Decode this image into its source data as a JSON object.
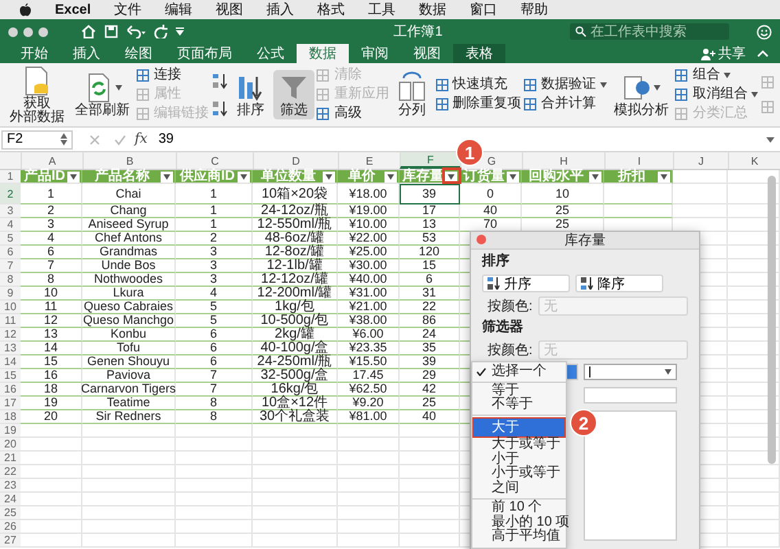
{
  "menu_bar": {
    "app": "Excel",
    "items": [
      "文件",
      "编辑",
      "视图",
      "插入",
      "格式",
      "工具",
      "数据",
      "窗口",
      "帮助"
    ]
  },
  "title_bar": {
    "title": "工作簿1",
    "search": {
      "placeholder": "在工作表中搜索"
    }
  },
  "tabs": [
    {
      "label": "开始",
      "selected": false,
      "kind": "normal"
    },
    {
      "label": "插入",
      "selected": false,
      "kind": "normal"
    },
    {
      "label": "绘图",
      "selected": false,
      "kind": "normal"
    },
    {
      "label": "页面布局",
      "selected": false,
      "kind": "normal"
    },
    {
      "label": "公式",
      "selected": false,
      "kind": "normal"
    },
    {
      "label": "数据",
      "selected": true,
      "kind": "normal"
    },
    {
      "label": "审阅",
      "selected": false,
      "kind": "normal"
    },
    {
      "label": "视图",
      "selected": false,
      "kind": "normal"
    },
    {
      "label": "表格",
      "selected": false,
      "kind": "contextual"
    }
  ],
  "share": "共享",
  "ribbon": {
    "groups": [
      {
        "kind": "big",
        "label_lines": [
          "获取",
          "外部数据"
        ],
        "pressed": false,
        "dropdown": false
      },
      {
        "kind": "big",
        "label": "全部刷新",
        "pressed": false,
        "dropdown": true
      },
      {
        "kind": "stack",
        "items": [
          {
            "label": "连接",
            "disabled": false,
            "dropdown": false
          },
          {
            "label": "属性",
            "disabled": true,
            "dropdown": false
          },
          {
            "label": "编辑链接",
            "disabled": true,
            "dropdown": false
          }
        ]
      },
      {
        "kind": "sort_icons"
      },
      {
        "kind": "big",
        "label": "排序",
        "pressed": false,
        "dropdown": false
      },
      {
        "kind": "big",
        "label": "筛选",
        "pressed": true,
        "dropdown": false
      },
      {
        "kind": "stack",
        "items": [
          {
            "label": "清除",
            "disabled": true,
            "dropdown": false
          },
          {
            "label": "重新应用",
            "disabled": true,
            "dropdown": false
          },
          {
            "label": "高级",
            "disabled": false,
            "dropdown": false
          }
        ]
      },
      {
        "kind": "big",
        "label": "分列",
        "pressed": false,
        "dropdown": false
      },
      {
        "kind": "stack",
        "items": [
          {
            "label": "快速填充",
            "disabled": false,
            "dropdown": false
          },
          {
            "label": "删除重复项",
            "disabled": false,
            "dropdown": false
          }
        ]
      },
      {
        "kind": "stack",
        "items": [
          {
            "label": "数据验证",
            "disabled": false,
            "dropdown": true
          },
          {
            "label": "合并计算",
            "disabled": false,
            "dropdown": false
          }
        ]
      },
      {
        "kind": "big",
        "label": "模拟分析",
        "pressed": false,
        "dropdown": true
      },
      {
        "kind": "stack",
        "items": [
          {
            "label": "组合",
            "disabled": false,
            "dropdown": true
          },
          {
            "label": "取消组合",
            "disabled": false,
            "dropdown": true
          },
          {
            "label": "分类汇总",
            "disabled": true,
            "dropdown": false
          }
        ]
      },
      {
        "kind": "outline_icons"
      }
    ]
  },
  "formula_bar": {
    "name_box": "F2",
    "function_label": "fx",
    "value": "39"
  },
  "sheet": {
    "columns": [
      "A",
      "B",
      "C",
      "D",
      "E",
      "F",
      "G",
      "H",
      "I",
      "J",
      "K"
    ],
    "rows": [
      {
        "number": "1",
        "kind": "header",
        "cells": [
          "产品ID",
          "产品名称",
          "供应商ID",
          "单位数量",
          "单价",
          "库存量",
          "订货量",
          "回购水平",
          "折扣"
        ]
      },
      {
        "number": "2",
        "kind": "data",
        "cells": [
          "1",
          "Chai",
          "1",
          "10箱×20袋",
          "¥18.00",
          {
            "text": "39",
            "selected": true
          },
          "0",
          "10"
        ]
      },
      {
        "number": "3",
        "kind": "data",
        "cells": [
          "2",
          "Chang",
          "1",
          "24-12oz/瓶",
          "¥19.00",
          "17",
          "40",
          "25"
        ]
      },
      {
        "number": "4",
        "kind": "data",
        "cells": [
          "3",
          "Aniseed Syrup",
          "1",
          "12-550ml/瓶",
          "¥10.00",
          "13",
          "70",
          "25"
        ]
      },
      {
        "number": "5",
        "kind": "data",
        "cells": [
          "4",
          "Chef Antons",
          "2",
          "48-6oz/罐",
          "¥22.00",
          "53"
        ]
      },
      {
        "number": "6",
        "kind": "data",
        "cells": [
          "6",
          "Grandmas",
          "3",
          "12-8oz/罐",
          "¥25.00",
          "120"
        ]
      },
      {
        "number": "7",
        "kind": "data",
        "cells": [
          "7",
          "Unde Bos",
          "3",
          "12-1lb/罐",
          "¥30.00",
          "15"
        ]
      },
      {
        "number": "8",
        "kind": "data",
        "cells": [
          "8",
          "Nothwoodes",
          "3",
          "12-12oz/罐",
          "¥40.00",
          "6"
        ]
      },
      {
        "number": "9",
        "kind": "data",
        "cells": [
          "10",
          "Lkura",
          "4",
          "12-200ml/罐",
          "¥31.00",
          "31"
        ]
      },
      {
        "number": "10",
        "kind": "data",
        "cells": [
          "11",
          "Queso Cabraies",
          "5",
          "1kg/包",
          "¥21.00",
          "22"
        ]
      },
      {
        "number": "11",
        "kind": "data",
        "cells": [
          "12",
          "Queso Manchgo",
          "5",
          "10-500g/包",
          "¥38.00",
          "86"
        ]
      },
      {
        "number": "12",
        "kind": "data",
        "cells": [
          "13",
          "Konbu",
          "6",
          "2kg/罐",
          "¥6.00",
          "24"
        ]
      },
      {
        "number": "13",
        "kind": "data",
        "cells": [
          "14",
          "Tofu",
          "6",
          "40-100g/盒",
          "¥23.35",
          "35"
        ]
      },
      {
        "number": "14",
        "kind": "data",
        "cells": [
          "15",
          "Genen Shouyu",
          "6",
          "24-250ml/瓶",
          "¥15.50",
          "39"
        ]
      },
      {
        "number": "15",
        "kind": "data",
        "cells": [
          "16",
          "Paviova",
          "7",
          "32-500g/盒",
          "17.45",
          "29"
        ]
      },
      {
        "number": "16",
        "kind": "data",
        "cells": [
          "18",
          "Carnarvon Tigers",
          "7",
          "16kg/包",
          "¥62.50",
          "42"
        ]
      },
      {
        "number": "17",
        "kind": "data",
        "cells": [
          "19",
          "Teatime",
          "8",
          "10盒×12件",
          "¥9.20",
          "25"
        ]
      },
      {
        "number": "18",
        "kind": "data",
        "cells": [
          "20",
          "Sir Redners",
          "8",
          "30个礼盒装",
          "¥81.00",
          "40"
        ]
      },
      {
        "number": "19",
        "kind": "empty"
      },
      {
        "number": "20",
        "kind": "empty"
      },
      {
        "number": "21",
        "kind": "empty"
      },
      {
        "number": "22",
        "kind": "empty"
      },
      {
        "number": "23",
        "kind": "empty"
      },
      {
        "number": "24",
        "kind": "empty"
      },
      {
        "number": "25",
        "kind": "empty"
      },
      {
        "number": "26",
        "kind": "empty"
      },
      {
        "number": "27",
        "kind": "empty"
      }
    ]
  },
  "filter_popup": {
    "title": "库存量",
    "sort_heading": "排序",
    "ascending": "升序",
    "descending": "降序",
    "sort_color_label": "按颜色:",
    "sort_color_value": "无",
    "filter_heading": "筛选器",
    "filter_color_label": "按颜色:",
    "filter_color_value": "无",
    "condition_menu": [
      {
        "kind": "item",
        "label": "选择一个",
        "checked": true,
        "selected": false
      },
      {
        "kind": "separator"
      },
      {
        "kind": "item",
        "label": "等于",
        "checked": false,
        "selected": false
      },
      {
        "kind": "item",
        "label": "不等于",
        "checked": false,
        "selected": false
      },
      {
        "kind": "separator"
      },
      {
        "kind": "item",
        "label": "大于",
        "checked": false,
        "selected": true
      },
      {
        "kind": "item",
        "label": "大于或等于",
        "checked": false,
        "selected": false
      },
      {
        "kind": "item",
        "label": "小于",
        "checked": false,
        "selected": false
      },
      {
        "kind": "item",
        "label": "小于或等于",
        "checked": false,
        "selected": false
      },
      {
        "kind": "item",
        "label": "之间",
        "checked": false,
        "selected": false
      },
      {
        "kind": "separator"
      },
      {
        "kind": "item",
        "label": "前 10 个",
        "checked": false,
        "selected": false
      },
      {
        "kind": "item",
        "label": "最小的 10 项",
        "checked": false,
        "selected": false
      },
      {
        "kind": "item",
        "label": "高于平均值",
        "checked": false,
        "selected": false
      }
    ]
  },
  "callouts": [
    {
      "label": "1"
    },
    {
      "label": "2"
    }
  ]
}
